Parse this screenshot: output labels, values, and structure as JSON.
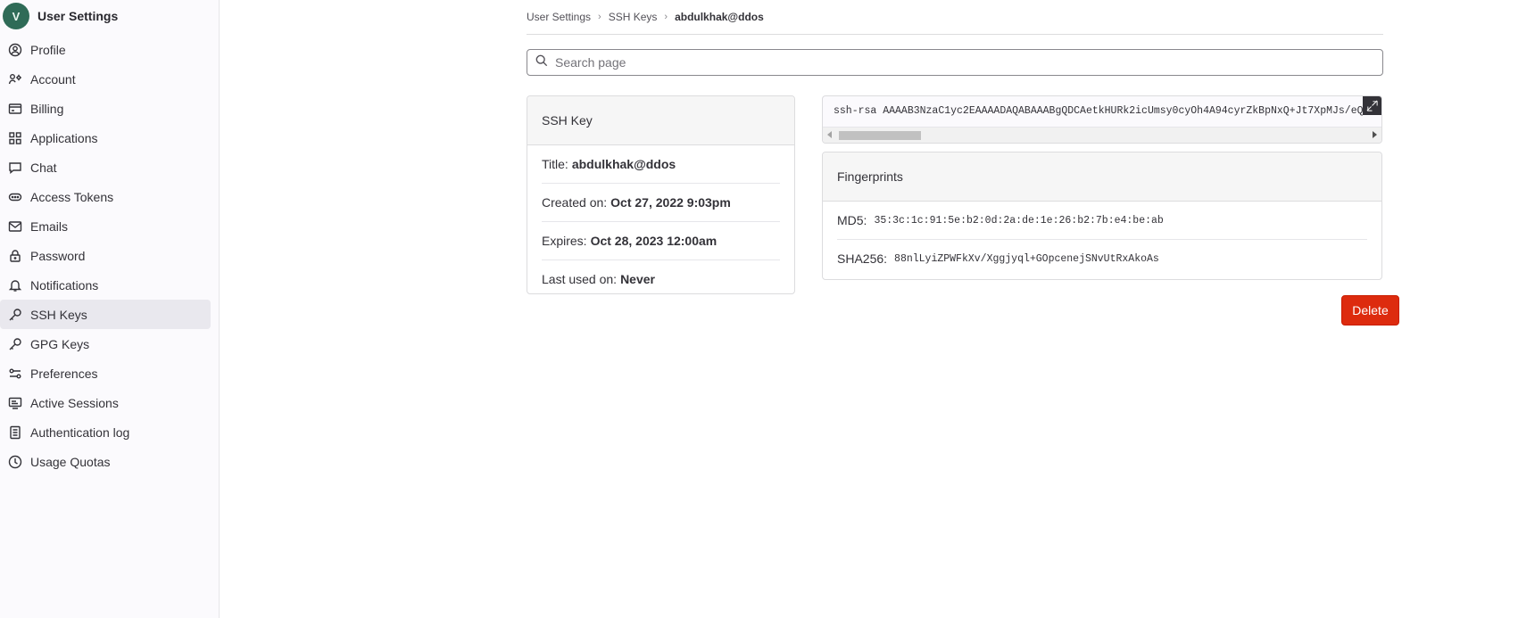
{
  "sidebar": {
    "avatar_letter": "V",
    "title": "User Settings",
    "items": [
      {
        "label": "Profile",
        "icon": "profile-icon"
      },
      {
        "label": "Account",
        "icon": "account-icon"
      },
      {
        "label": "Billing",
        "icon": "billing-icon"
      },
      {
        "label": "Applications",
        "icon": "applications-icon"
      },
      {
        "label": "Chat",
        "icon": "chat-icon"
      },
      {
        "label": "Access Tokens",
        "icon": "token-icon"
      },
      {
        "label": "Emails",
        "icon": "mail-icon"
      },
      {
        "label": "Password",
        "icon": "lock-icon"
      },
      {
        "label": "Notifications",
        "icon": "bell-icon"
      },
      {
        "label": "SSH Keys",
        "icon": "key-icon",
        "active": true
      },
      {
        "label": "GPG Keys",
        "icon": "key-icon"
      },
      {
        "label": "Preferences",
        "icon": "preferences-icon"
      },
      {
        "label": "Active Sessions",
        "icon": "monitor-icon"
      },
      {
        "label": "Authentication log",
        "icon": "log-icon"
      },
      {
        "label": "Usage Quotas",
        "icon": "quota-icon"
      }
    ]
  },
  "breadcrumb": {
    "items": [
      "User Settings",
      "SSH Keys"
    ],
    "current": "abdulkhak@ddos"
  },
  "search": {
    "placeholder": "Search page"
  },
  "ssh_key_card": {
    "header": "SSH Key",
    "title_label": "Title:",
    "title_value": "abdulkhak@ddos",
    "created_label": "Created on:",
    "created_value": "Oct 27, 2022 9:03pm",
    "expires_label": "Expires:",
    "expires_value": "Oct 28, 2023 12:00am",
    "last_used_label": "Last used on:",
    "last_used_value": "Never"
  },
  "key_text": "ssh-rsa AAAAB3NzaC1yc2EAAAADAQABAAABgQDCAetkHURk2icUmsy0cyOh4A94cyrZkBpNxQ+Jt7XpMJs/eQ",
  "fingerprints": {
    "header": "Fingerprints",
    "md5_label": "MD5:",
    "md5_value": "35:3c:1c:91:5e:b2:0d:2a:de:1e:26:b2:7b:e4:be:ab",
    "sha256_label": "SHA256:",
    "sha256_value": "88nlLyiZPWFkXv/Xggjyql+GOpcenejSNvUtRxAkoAs"
  },
  "delete_label": "Delete",
  "colors": {
    "danger": "#dd2b0e",
    "active_nav": "#e9e8ee"
  }
}
